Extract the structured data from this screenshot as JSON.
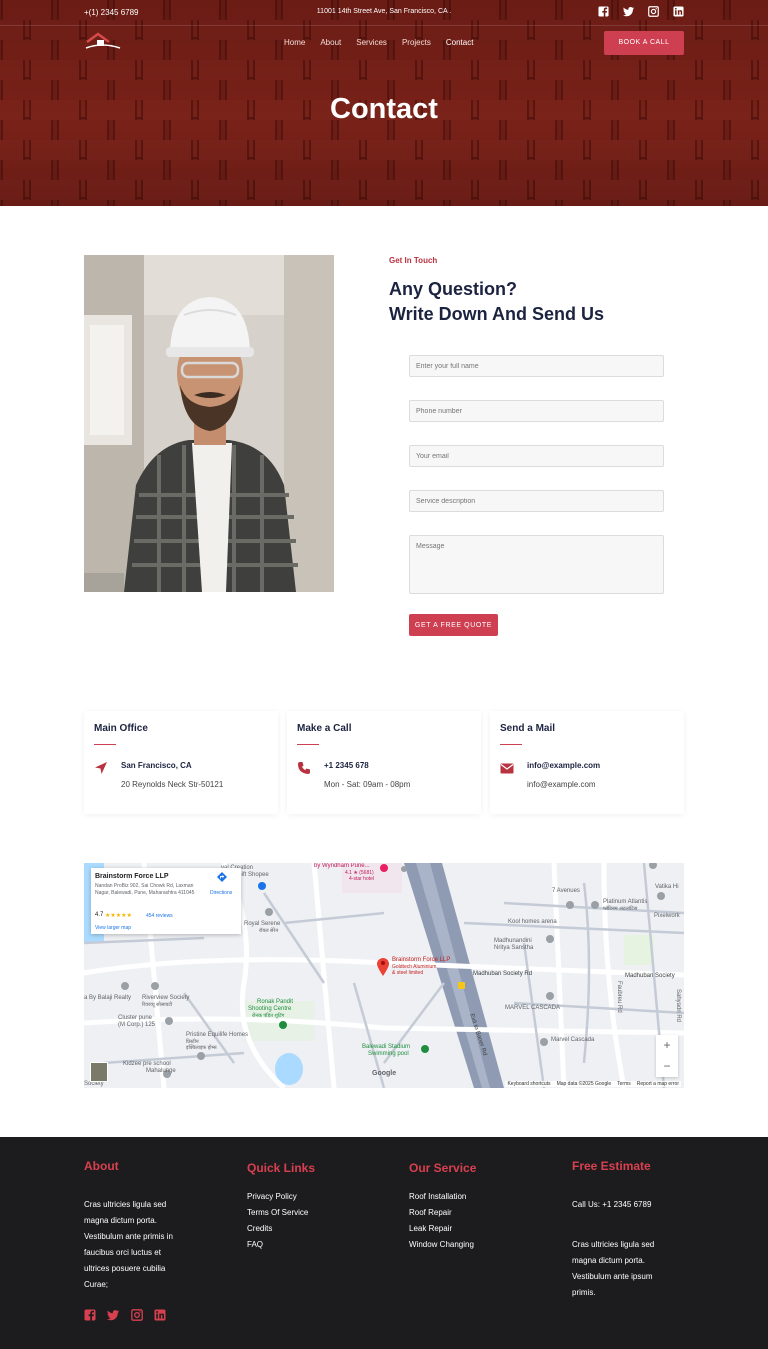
{
  "topbar": {
    "phone": "+(1) 2345 6789",
    "address": "11001 14th Street Ave, San Francisco, CA ."
  },
  "nav": {
    "items": [
      "Home",
      "About",
      "Services",
      "Projects",
      "Contact"
    ],
    "active": "Contact",
    "book_button": "BOOK A CALL"
  },
  "hero": {
    "title": "Contact"
  },
  "contact": {
    "eyebrow": "Get In Touch",
    "heading_line1": "Any Question?",
    "heading_line2": "Write Down And Send Us",
    "form": {
      "name_placeholder": "Enter your full name",
      "phone_placeholder": "Phone number",
      "email_placeholder": "Your email",
      "service_placeholder": "Service description",
      "message_placeholder": "Message",
      "submit": "GET A FREE QUOTE"
    }
  },
  "cards": [
    {
      "title": "Main Office",
      "line1": "San Francisco, CA",
      "line2": "20 Reynolds Neck Str-50121",
      "icon": "location-arrow-icon"
    },
    {
      "title": "Make a Call",
      "line1": "+1 2345 678",
      "line2": "Mon - Sat: 09am - 08pm",
      "icon": "phone-icon"
    },
    {
      "title": "Send a Mail",
      "line1": "info@example.com",
      "line2": "info@example.com",
      "icon": "envelope-icon"
    }
  ],
  "map": {
    "place_name": "Brainstorm Force LLP",
    "address": "Nandan ProBiz 902, Sai Chowk Rd, Laxman Nagar, Balewadi, Pune, Maharashtra 411045",
    "rating": "4.7",
    "stars": "★★★★★",
    "reviews": "454 reviews",
    "directions": "Directions",
    "view_larger": "View larger map",
    "zoom_in": "+",
    "zoom_out": "−",
    "google": "Google",
    "footer_links": [
      "Keyboard shortcuts",
      "Map data ©2025 Google",
      "Terms",
      "Report a map error"
    ],
    "labels": {
      "creation": "val Creation",
      "gift": "Gift Shopee",
      "wyndham": "by Wyndham Pune...",
      "wyndham_rating": "4.1 ★ (5681)",
      "wyndham_type": "4-star hotel",
      "royal": "Royal Serene",
      "royal_local": "रॉयल सेरेन",
      "pin_name": "Brainstorm Force LLP",
      "pin_sub1": "Goldtech Aluminium",
      "pin_sub2": "& steel limited",
      "seven": "7 Avenues",
      "vatika": "Vatika Hi",
      "platinum": "Platinum Atlantis",
      "platinum_local": "प्लॅटिनम अटलांटिस",
      "pixelwork": "Pixelwork",
      "kool": "Kool homes arena",
      "madhunandini": "Madhunandini",
      "nritya": "Nritya Sanstha",
      "madhuban1": "Madhuban Society Rd",
      "madhuban2": "Madhuban Society",
      "balaji": "a By Balaji Realty",
      "riverview": "Riverview Society",
      "riverview_local": "रिवरव्यू सोसायटी",
      "ronak1": "Ronak Pandit",
      "ronak2": "Shooting Centre",
      "ronak_local": "रोनक पंडित शूटिंग",
      "exit": "Exit to Baner Rd",
      "marvel": "MARVEL CASCADA",
      "marvel2": "Marvel Cascada",
      "cluster1": "Cluster pune",
      "cluster2": "(M Corp.) 125",
      "pristine": "Pristine Equilife Homes",
      "pristine_local1": "प्रिस्टीन",
      "pristine_local2": "इक्विलाइफ होम्स",
      "balewadi1": "Balewadi Stadium",
      "balewadi2": "Swimming pool",
      "kidzee1": "Kidzee pre school",
      "kidzee2": "Mahalunge",
      "society": "Society",
      "faubreu": "Faubreu Rd",
      "sahyadri": "Sahyadri Rd"
    }
  },
  "footer": {
    "about_title": "About",
    "about_text": [
      "Cras ultricies ligula sed",
      "magna dictum porta.",
      "Vestibulum ante primis in",
      "faucibus orci luctus et",
      "ultrices posuere cubilia",
      "Curae;"
    ],
    "quick_title": "Quick Links",
    "quick_links": [
      "Privacy Policy",
      "Terms Of Service",
      "Credits",
      "FAQ"
    ],
    "service_title": "Our Service",
    "service_links": [
      "Roof Installation",
      "Roof Repair",
      "Leak Repair",
      "Window Changing"
    ],
    "estimate_title": "Free Estimate",
    "estimate_call": "Call Us: +1 2345 6789",
    "estimate_text": [
      "Cras ultricies ligula sed",
      "magna dictum porta.",
      "Vestibulum ante ipsum",
      "primis."
    ]
  },
  "colors": {
    "accent": "#cf3f52",
    "navy": "#1c2340",
    "footer_bg": "#1c1c1e",
    "hero_bg": "#6e1d15"
  },
  "icons": [
    "facebook-icon",
    "twitter-icon",
    "instagram-icon",
    "linkedin-icon",
    "logo-house-icon",
    "location-arrow-icon",
    "phone-icon",
    "envelope-icon",
    "map-pin-icon",
    "directions-icon"
  ]
}
